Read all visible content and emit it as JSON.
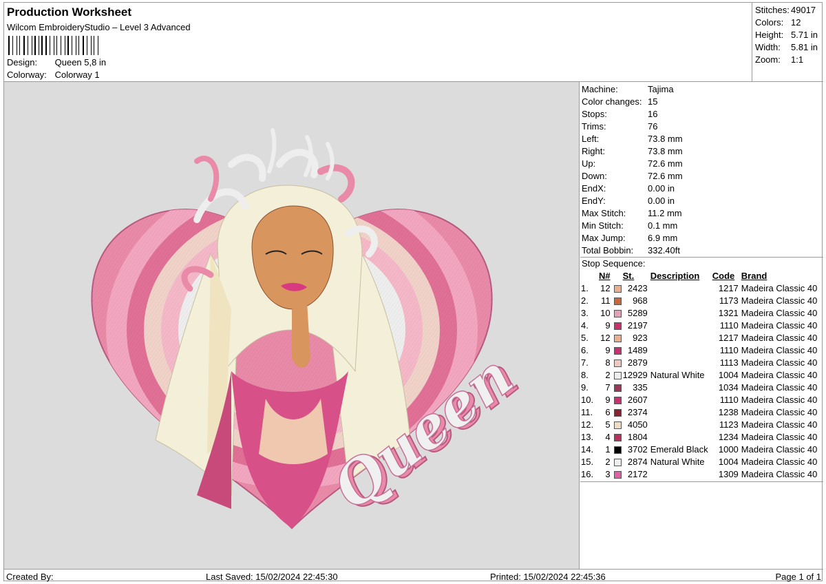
{
  "header": {
    "title": "Production Worksheet",
    "subtitle": "Wilcom EmbroideryStudio – Level 3 Advanced",
    "design_label": "Design:",
    "design_value": "Queen 5,8 in",
    "colorway_label": "Colorway:",
    "colorway_value": "Colorway 1"
  },
  "stats": {
    "stitches_label": "Stitches:",
    "stitches": "49017",
    "colors_label": "Colors:",
    "colors": "12",
    "height_label": "Height:",
    "height": "5.71 in",
    "width_label": "Width:",
    "width": "5.81 in",
    "zoom_label": "Zoom:",
    "zoom": "1:1"
  },
  "machine": {
    "rows": [
      {
        "label": "Machine:",
        "value": "Tajima"
      },
      {
        "label": "Color changes:",
        "value": "15"
      },
      {
        "label": "Stops:",
        "value": "16"
      },
      {
        "label": "Trims:",
        "value": "76"
      },
      {
        "label": "Left:",
        "value": "73.8 mm"
      },
      {
        "label": "Right:",
        "value": "73.8 mm"
      },
      {
        "label": "Up:",
        "value": "72.6 mm"
      },
      {
        "label": "Down:",
        "value": "72.6 mm"
      },
      {
        "label": "EndX:",
        "value": "0.00 in"
      },
      {
        "label": "EndY:",
        "value": "0.00 in"
      },
      {
        "label": "Max Stitch:",
        "value": "11.2 mm"
      },
      {
        "label": "Min Stitch:",
        "value": "0.1 mm"
      },
      {
        "label": "Max Jump:",
        "value": "6.9 mm"
      },
      {
        "label": "Total Bobbin:",
        "value": "332.40ft"
      }
    ]
  },
  "sequence": {
    "title": "Stop Sequence:",
    "headers": {
      "n": "N#",
      "st": "St.",
      "desc": "Description",
      "code": "Code",
      "brand": "Brand"
    },
    "rows": [
      {
        "idx": "1.",
        "n": "12",
        "color": "#e8b08e",
        "st": "2423",
        "desc": "",
        "code": "1217",
        "brand": "Madeira Classic 40"
      },
      {
        "idx": "2.",
        "n": "11",
        "color": "#c8683a",
        "st": "968",
        "desc": "",
        "code": "1173",
        "brand": "Madeira Classic 40"
      },
      {
        "idx": "3.",
        "n": "10",
        "color": "#e8a0b8",
        "st": "5289",
        "desc": "",
        "code": "1321",
        "brand": "Madeira Classic 40"
      },
      {
        "idx": "4.",
        "n": "9",
        "color": "#c83070",
        "st": "2197",
        "desc": "",
        "code": "1110",
        "brand": "Madeira Classic 40"
      },
      {
        "idx": "5.",
        "n": "12",
        "color": "#e8b08e",
        "st": "923",
        "desc": "",
        "code": "1217",
        "brand": "Madeira Classic 40"
      },
      {
        "idx": "6.",
        "n": "9",
        "color": "#c83070",
        "st": "1489",
        "desc": "",
        "code": "1110",
        "brand": "Madeira Classic 40"
      },
      {
        "idx": "7.",
        "n": "8",
        "color": "#f0c8c0",
        "st": "2879",
        "desc": "",
        "code": "1113",
        "brand": "Madeira Classic 40"
      },
      {
        "idx": "8.",
        "n": "2",
        "color": "#eeeeee",
        "st": "12929",
        "desc": "Natural White",
        "code": "1004",
        "brand": "Madeira Classic 40"
      },
      {
        "idx": "9.",
        "n": "7",
        "color": "#9a3858",
        "st": "335",
        "desc": "",
        "code": "1034",
        "brand": "Madeira Classic 40"
      },
      {
        "idx": "10.",
        "n": "9",
        "color": "#c83070",
        "st": "2607",
        "desc": "",
        "code": "1110",
        "brand": "Madeira Classic 40"
      },
      {
        "idx": "11.",
        "n": "6",
        "color": "#8a2030",
        "st": "2374",
        "desc": "",
        "code": "1238",
        "brand": "Madeira Classic 40"
      },
      {
        "idx": "12.",
        "n": "5",
        "color": "#f0dcc0",
        "st": "4050",
        "desc": "",
        "code": "1123",
        "brand": "Madeira Classic 40"
      },
      {
        "idx": "13.",
        "n": "4",
        "color": "#b83060",
        "st": "1804",
        "desc": "",
        "code": "1234",
        "brand": "Madeira Classic 40"
      },
      {
        "idx": "14.",
        "n": "1",
        "color": "#000000",
        "st": "3702",
        "desc": "Emerald Black",
        "code": "1000",
        "brand": "Madeira Classic 40"
      },
      {
        "idx": "15.",
        "n": "2",
        "color": "#eeeeee",
        "st": "2874",
        "desc": "Natural White",
        "code": "1004",
        "brand": "Madeira Classic 40"
      },
      {
        "idx": "16.",
        "n": "3",
        "color": "#e060a8",
        "st": "2172",
        "desc": "",
        "code": "1309",
        "brand": "Madeira Classic 40"
      }
    ]
  },
  "preview": {
    "word": "Queen"
  },
  "footer": {
    "created": "Created By:",
    "saved": "Last Saved: 15/02/2024 22:45:30",
    "printed": "Printed: 15/02/2024 22:45:36",
    "page": "Page 1 of 1"
  }
}
